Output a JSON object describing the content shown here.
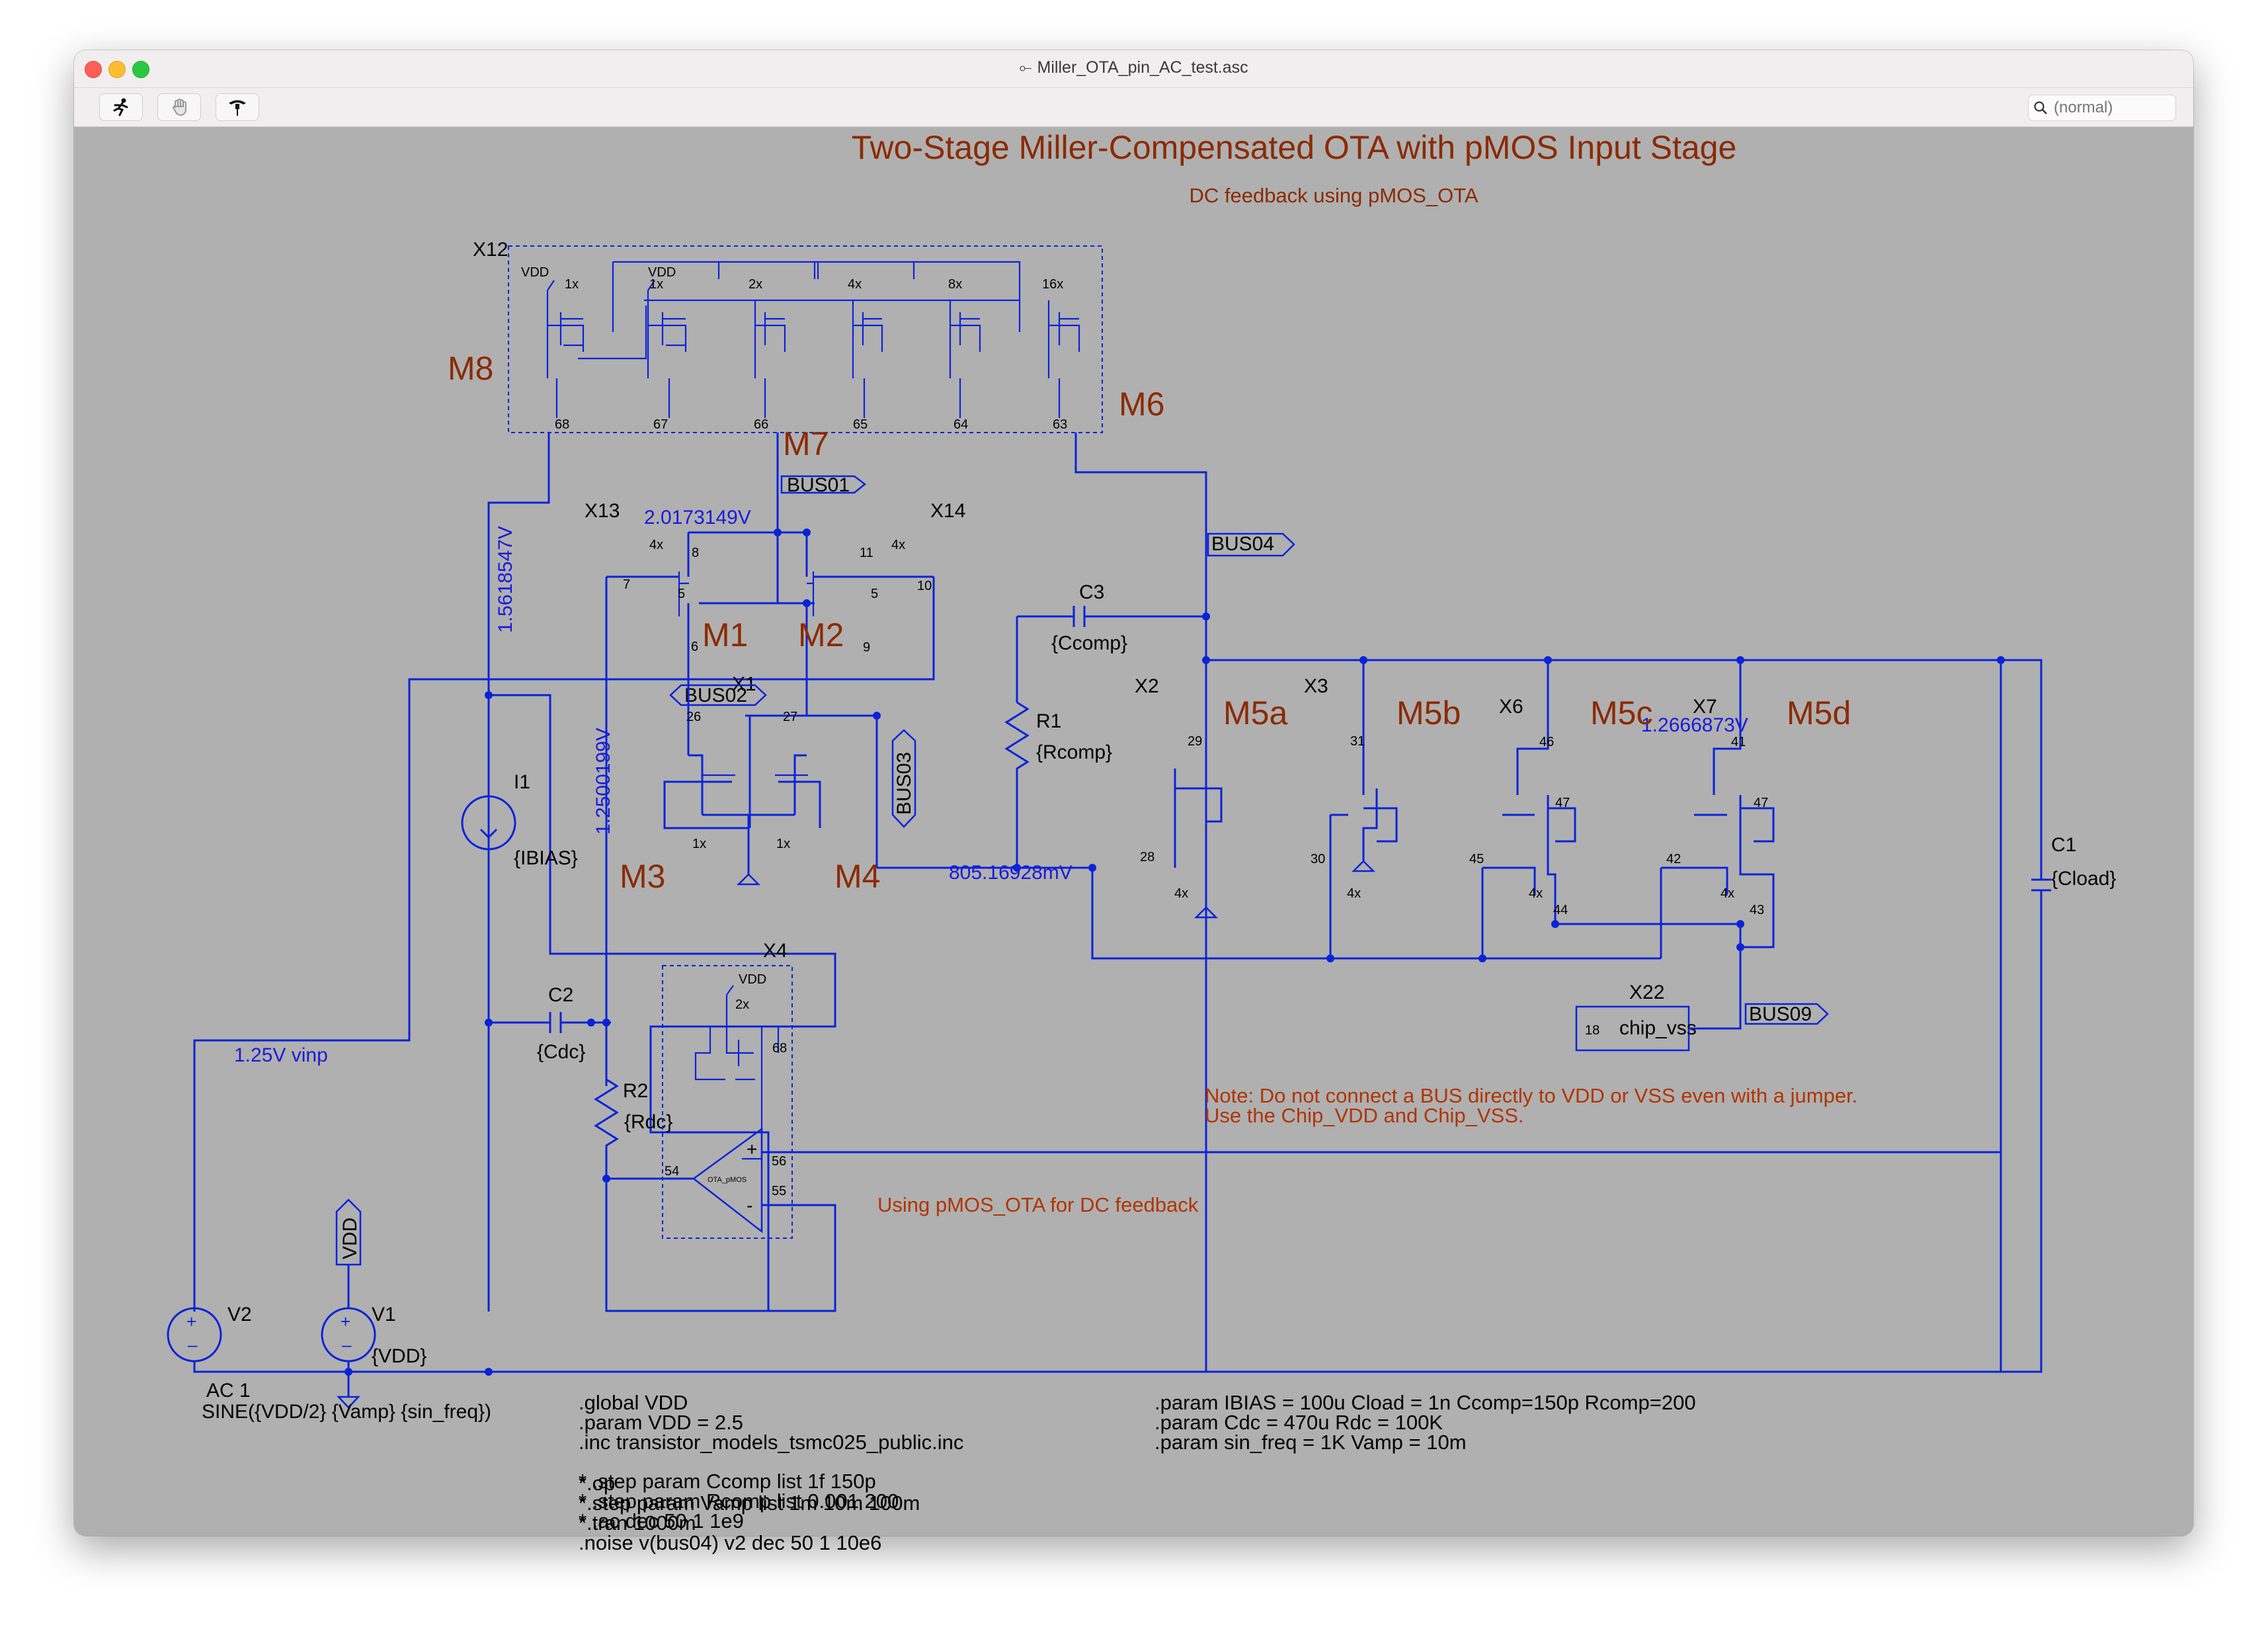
{
  "window": {
    "title": "Miller_OTA_pin_AC_test.asc"
  },
  "toolbar": {
    "tools": [
      {
        "name": "run-icon"
      },
      {
        "name": "halt-hand-icon"
      },
      {
        "name": "probe-icon"
      }
    ],
    "search_placeholder": "(normal)"
  },
  "schematic": {
    "title": "Two-Stage Miller-Compensated OTA with pMOS Input Stage",
    "subtitle": "DC feedback using pMOS_OTA",
    "device_labels": {
      "m8": "M8",
      "m7": "M7",
      "m6": "M6",
      "m1": "M1",
      "m2": "M2",
      "m3": "M3",
      "m4": "M4",
      "m5a": "M5a",
      "m5b": "M5b",
      "m5c": "M5c",
      "m5d": "M5d"
    },
    "instances": {
      "x12": "X12",
      "x13": "X13",
      "x14": "X14",
      "x1": "X1",
      "x2": "X2",
      "x3": "X3",
      "x6": "X6",
      "x7": "X7",
      "x4": "X4",
      "x22": "X22"
    },
    "buses": {
      "bus01": "BUS01",
      "bus02": "BUS02",
      "bus03": "BUS03",
      "bus04": "BUS04",
      "bus09": "BUS09"
    },
    "voltages": {
      "v_2017": "2.0173149V",
      "v_1561": "1.5618547V",
      "v_1250": "1.2500199V",
      "v_805": "805.16928mV",
      "v_1266": "1.2666873V",
      "vinp": "1.25V vinp"
    },
    "components": {
      "c3": "C3",
      "c3_val": "{Ccomp}",
      "r1": "R1",
      "r1_val": "{Rcomp}",
      "c1": "C1",
      "c1_val": "{Cload}",
      "c2": "C2",
      "c2_val": "{Cdc}",
      "r2": "R2",
      "r2_val": "{Rdc}",
      "i1": "I1",
      "i1_val": "{IBIAS}",
      "v1": "V1",
      "v1_val": "{VDD}",
      "v2": "V2",
      "vdd_flag": "VDD",
      "chip_vss": "chip_vss",
      "ota_name": "OTA_pMOS",
      "v2_ac": "AC 1",
      "v2_sine": "SINE({VDD/2} {Vamp} {sin_freq})"
    },
    "pins": {
      "p68": "68",
      "p67": "67",
      "p66": "66",
      "p65": "65",
      "p64": "64",
      "p63": "63",
      "p8": "8",
      "p7": "7",
      "p5a": "5",
      "p5b": "5",
      "p6": "6",
      "p11": "11",
      "p10": "10",
      "p9": "9",
      "p26": "26",
      "p27": "27",
      "p29": "29",
      "p28": "28",
      "p31": "31",
      "p30": "30",
      "p46": "46",
      "p47a": "47",
      "p45": "45",
      "p44": "44",
      "p41": "41",
      "p47b": "47",
      "p42": "42",
      "p43": "43",
      "p18": "18",
      "p54": "54",
      "p56": "56",
      "p55": "55",
      "p68b": "68"
    },
    "multipliers": {
      "x12": [
        "1x",
        "1x",
        "2x",
        "4x",
        "8x",
        "16x"
      ],
      "m1": "4x",
      "m2": "4x",
      "m3": "1x",
      "m4": "1x",
      "m5a": "4x",
      "m5b": "4x",
      "m5c": "4x",
      "m5d": "4x",
      "x4": "2x"
    },
    "notes": {
      "warn1": "Note: Do not connect a BUS directly to VDD or VSS even with a jumper.",
      "warn2": "Use the Chip_VDD and Chip_VSS.",
      "using_pmos": "Using pMOS_OTA for DC feedback"
    },
    "directives_left": [
      ".global VDD",
      ".param VDD = 2.5",
      ".inc transistor_models_tsmc025_public.inc"
    ],
    "directives_right": [
      ".param IBIAS = 100u Cload = 1n Ccomp=150p Rcomp=200",
      ".param Cdc = 470u Rdc = 100K",
      ".param sin_freq = 1K Vamp = 10m"
    ],
    "directives_bottom": [
      "* .step param Ccomp list 1f 150p",
      "* .step param Rcomp list 0.001 200",
      "* .ac dec 50 1 1e9",
      "*.op",
      "*.step param Vamp list 1m 10m 100m",
      "*.tran 1000m",
      ".noise v(bus04) v2 dec 50 1 10e6"
    ]
  }
}
